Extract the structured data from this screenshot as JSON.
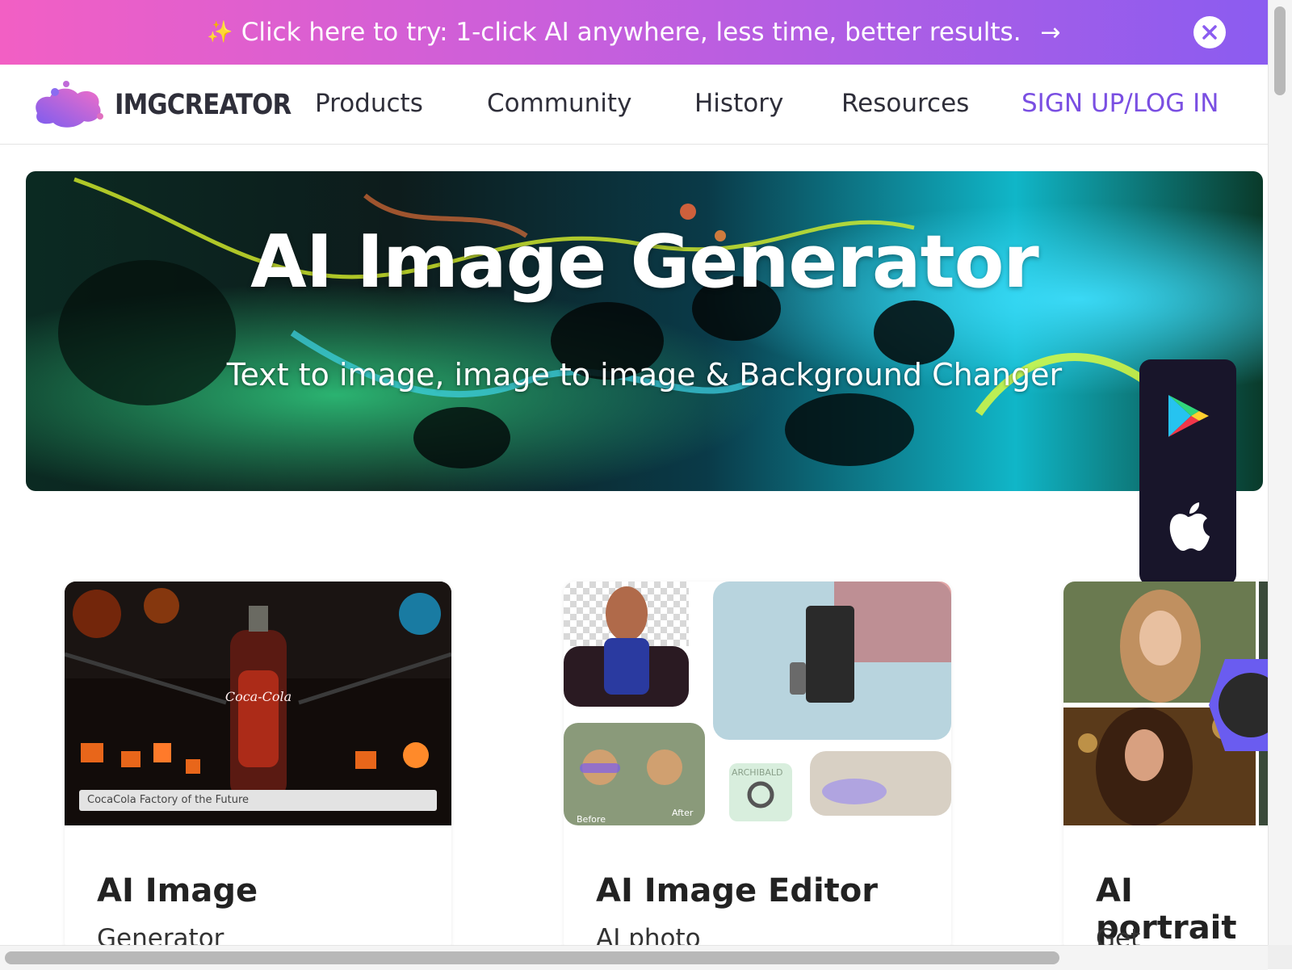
{
  "banner": {
    "sparkle": "✨",
    "text": "Click here to try: 1-click AI anywhere, less time, better results.",
    "arrow": "→",
    "close_icon": "close-icon"
  },
  "navbar": {
    "logo_text": "IMGCREATOR",
    "items": [
      {
        "label": "Products"
      },
      {
        "label": "Community"
      },
      {
        "label": "History"
      },
      {
        "label": "Resources"
      }
    ],
    "signup_label": "SIGN UP/LOG IN"
  },
  "hero": {
    "title": "AI Image Generator",
    "subtitle": "Text to image, image to image & Background Changer"
  },
  "app_badges": [
    {
      "icon": "google-play-icon"
    },
    {
      "icon": "apple-icon"
    }
  ],
  "cards": [
    {
      "title": "AI Image",
      "desc": "Generator",
      "caption": "CocaCola Factory of the Future"
    },
    {
      "title": "AI Image Editor",
      "desc": "AI photo",
      "before_label": "Before",
      "after_label": "After",
      "product_label": "ARCHIBALD"
    },
    {
      "title": "AI portrait",
      "desc": "Get"
    }
  ],
  "colors": {
    "banner_start": "#f25fc4",
    "banner_end": "#8b5cf0",
    "signup": "#7a4fe2",
    "app_panel": "#18152a"
  }
}
